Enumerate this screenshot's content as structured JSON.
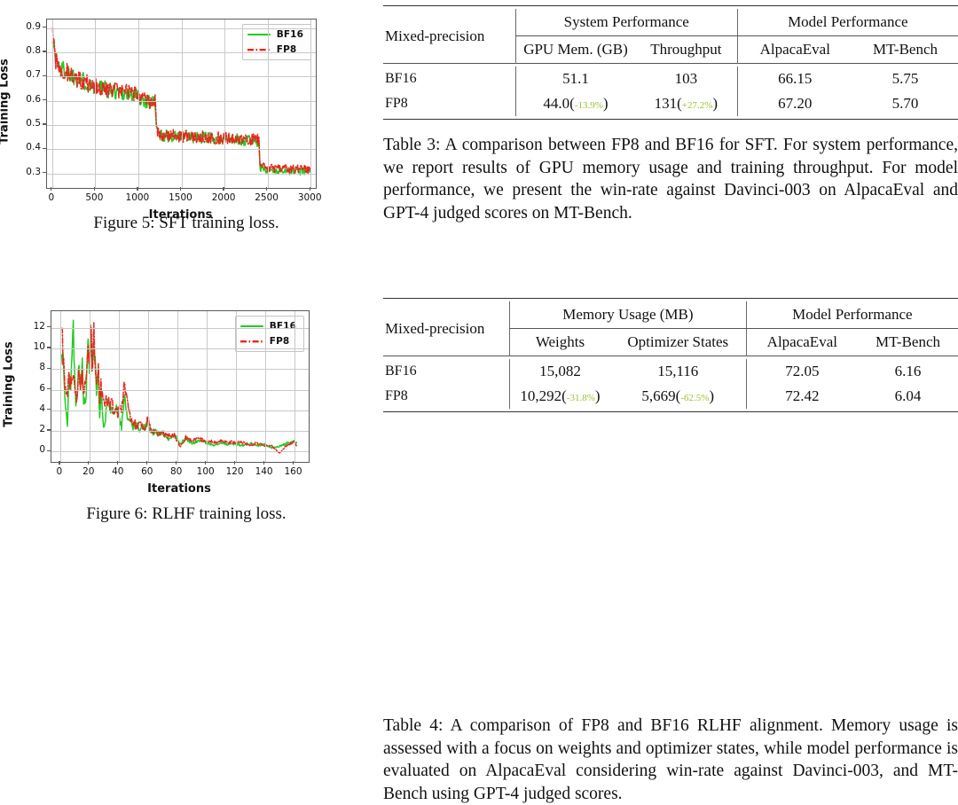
{
  "figures": [
    {
      "id": "figure5",
      "caption": "Figure 5: SFT training loss.",
      "chart_data": {
        "type": "line",
        "title": "",
        "xlabel": "Iterations",
        "ylabel": "Training Loss",
        "xlim": [
          -60,
          3060
        ],
        "ylim": [
          0.24,
          0.935
        ],
        "xticks": [
          "0",
          "500",
          "1000",
          "1500",
          "2000",
          "2500",
          "3000"
        ],
        "xtick_values": [
          0,
          500,
          1000,
          1500,
          2000,
          2500,
          3000
        ],
        "yticks": [
          "0.9",
          "0.8",
          "0.7",
          "0.6",
          "0.5",
          "0.4",
          "0.3"
        ],
        "ytick_values": [
          0.9,
          0.8,
          0.7,
          0.6,
          0.5,
          0.4,
          0.3
        ],
        "grid": true,
        "legend_position": "upper right",
        "series": [
          {
            "name": "BF16",
            "color": "#22cc22",
            "style": "solid",
            "x": [
              0,
              30,
              60,
              100,
              150,
              200,
              260,
              320,
              380,
              440,
              500,
              560,
              620,
              680,
              740,
              800,
              860,
              920,
              980,
              1040,
              1100,
              1160,
              1200,
              1210,
              1260,
              1320,
              1400,
              1480,
              1560,
              1640,
              1720,
              1800,
              1880,
              1960,
              2040,
              2120,
              2200,
              2280,
              2360,
              2400,
              2410,
              2480,
              2560,
              2640,
              2720,
              2800,
              2880,
              2960,
              3000
            ],
            "values": [
              0.89,
              0.79,
              0.755,
              0.735,
              0.722,
              0.712,
              0.7,
              0.69,
              0.678,
              0.668,
              0.66,
              0.655,
              0.648,
              0.643,
              0.64,
              0.636,
              0.632,
              0.628,
              0.618,
              0.607,
              0.6,
              0.596,
              0.592,
              0.475,
              0.458,
              0.455,
              0.452,
              0.45,
              0.45,
              0.448,
              0.447,
              0.446,
              0.444,
              0.443,
              0.442,
              0.44,
              0.438,
              0.437,
              0.436,
              0.434,
              0.322,
              0.318,
              0.315,
              0.313,
              0.312,
              0.311,
              0.31,
              0.309,
              0.308
            ]
          },
          {
            "name": "FP8",
            "color": "#e8271f",
            "style": "dashdot",
            "x": [
              0,
              30,
              60,
              100,
              150,
              200,
              260,
              320,
              380,
              440,
              500,
              560,
              620,
              680,
              740,
              800,
              860,
              920,
              980,
              1040,
              1100,
              1160,
              1200,
              1210,
              1260,
              1320,
              1400,
              1480,
              1560,
              1640,
              1720,
              1800,
              1880,
              1960,
              2040,
              2120,
              2200,
              2280,
              2360,
              2400,
              2410,
              2480,
              2560,
              2640,
              2720,
              2800,
              2880,
              2960,
              3000
            ],
            "values": [
              0.888,
              0.785,
              0.752,
              0.733,
              0.72,
              0.71,
              0.698,
              0.688,
              0.676,
              0.667,
              0.659,
              0.654,
              0.647,
              0.644,
              0.641,
              0.638,
              0.634,
              0.63,
              0.62,
              0.609,
              0.602,
              0.597,
              0.593,
              0.478,
              0.461,
              0.458,
              0.456,
              0.454,
              0.453,
              0.451,
              0.45,
              0.449,
              0.447,
              0.446,
              0.445,
              0.443,
              0.441,
              0.44,
              0.439,
              0.437,
              0.328,
              0.325,
              0.322,
              0.32,
              0.319,
              0.318,
              0.317,
              0.316,
              0.315
            ]
          }
        ]
      }
    },
    {
      "id": "figure6",
      "caption": "Figure 6: RLHF training loss.",
      "chart_data": {
        "type": "line",
        "title": "",
        "xlabel": "Iterations",
        "ylabel": "Training Loss",
        "xlim": [
          -6,
          170
        ],
        "ylim": [
          -1.0,
          13.6
        ],
        "xticks": [
          "0",
          "20",
          "40",
          "60",
          "80",
          "100",
          "120",
          "140",
          "160"
        ],
        "xtick_values": [
          0,
          20,
          40,
          60,
          80,
          100,
          120,
          140,
          160
        ],
        "yticks": [
          "12",
          "10",
          "8",
          "6",
          "4",
          "2",
          "0"
        ],
        "ytick_values": [
          12,
          10,
          8,
          6,
          4,
          2,
          0
        ],
        "grid": true,
        "legend_position": "upper right",
        "series": [
          {
            "name": "BF16",
            "color": "#22cc22",
            "style": "solid",
            "x": [
              1,
              3,
              5,
              6,
              7,
              9,
              10,
              11,
              13,
              14,
              15,
              16,
              18,
              19,
              20,
              21,
              22,
              23,
              24,
              25,
              26,
              27,
              28,
              30,
              32,
              34,
              36,
              38,
              40,
              42,
              44,
              46,
              48,
              50,
              52,
              55,
              58,
              60,
              62,
              65,
              68,
              70,
              74,
              78,
              82,
              86,
              90,
              95,
              100,
              105,
              110,
              115,
              120,
              125,
              130,
              135,
              140,
              145,
              150,
              155,
              160,
              162
            ],
            "values": [
              11.2,
              6.0,
              2.9,
              8.5,
              5.2,
              11.5,
              6.2,
              4.5,
              8.0,
              5.5,
              9.0,
              4.0,
              6.5,
              11.0,
              7.5,
              13.1,
              6.8,
              11.0,
              8.2,
              5.2,
              8.3,
              3.1,
              5.8,
              2.0,
              4.9,
              4.2,
              3.6,
              4.0,
              3.9,
              2.3,
              5.5,
              3.1,
              3.3,
              2.4,
              2.7,
              2.0,
              2.4,
              2.9,
              1.6,
              2.1,
              1.5,
              1.9,
              1.1,
              1.7,
              0.7,
              1.3,
              0.8,
              1.0,
              0.85,
              0.6,
              0.9,
              0.7,
              0.75,
              0.6,
              0.8,
              0.55,
              0.7,
              0.35,
              0.5,
              0.8,
              0.95,
              0.75
            ]
          },
          {
            "name": "FP8",
            "color": "#e8271f",
            "style": "dashdot",
            "x": [
              1,
              3,
              5,
              6,
              7,
              9,
              10,
              11,
              13,
              14,
              15,
              16,
              18,
              19,
              20,
              21,
              22,
              23,
              24,
              25,
              26,
              27,
              28,
              30,
              32,
              34,
              36,
              38,
              40,
              42,
              44,
              46,
              48,
              50,
              52,
              55,
              58,
              60,
              62,
              65,
              68,
              70,
              74,
              78,
              82,
              86,
              90,
              95,
              100,
              105,
              110,
              115,
              120,
              125,
              130,
              135,
              140,
              145,
              150,
              155,
              160,
              162
            ],
            "values": [
              11.4,
              6.8,
              5.6,
              8.0,
              6.0,
              8.8,
              7.1,
              5.2,
              7.7,
              6.4,
              8.0,
              5.0,
              7.2,
              9.8,
              8.4,
              11.6,
              8.0,
              11.2,
              9.0,
              6.3,
              9.1,
              4.4,
              6.4,
              4.5,
              5.0,
              4.6,
              4.4,
              4.1,
              3.8,
              4.4,
              6.3,
              4.4,
              3.0,
              3.0,
              2.5,
              2.6,
              2.2,
              3.4,
              1.9,
              2.0,
              1.7,
              1.8,
              1.5,
              1.6,
              0.45,
              1.4,
              1.1,
              1.2,
              1.05,
              0.95,
              1.0,
              0.95,
              0.85,
              0.9,
              0.6,
              0.85,
              0.6,
              0.55,
              -0.15,
              0.6,
              1.0,
              0.45
            ]
          }
        ]
      }
    }
  ],
  "table3": {
    "group_header_left": "Mixed-precision",
    "group_headers": [
      "System Performance",
      "Model Performance"
    ],
    "sub_headers": [
      "GPU Mem. (GB)",
      "Throughput",
      "AlpacaEval",
      "MT-Bench"
    ],
    "rows": [
      {
        "name": "BF16",
        "gpu_mem": "51.1",
        "gpu_mem_delta": "",
        "throughput": "103",
        "throughput_delta": "",
        "alpaca_eval": "66.15",
        "mt_bench": "5.75"
      },
      {
        "name": "FP8",
        "gpu_mem": "44.0",
        "gpu_mem_delta": "-13.9%",
        "throughput": "131",
        "throughput_delta": "+27.2%",
        "alpaca_eval": "67.20",
        "mt_bench": "5.70"
      }
    ],
    "caption": "Table 3: A comparison between FP8 and BF16 for SFT. For system performance, we report results of GPU memory usage and training throughput. For model performance, we present the win-rate against Davinci-003 on AlpacaEval and GPT-4 judged scores on MT-Bench."
  },
  "table4": {
    "group_header_left": "Mixed-precision",
    "group_headers": [
      "Memory Usage (MB)",
      "Model Performance"
    ],
    "sub_headers": [
      "Weights",
      "Optimizer States",
      "AlpacaEval",
      "MT-Bench"
    ],
    "rows": [
      {
        "name": "BF16",
        "weights": "15,082",
        "weights_delta": "",
        "optimizer_states": "15,116",
        "optimizer_states_delta": "",
        "alpaca_eval": "72.05",
        "mt_bench": "6.16"
      },
      {
        "name": "FP8",
        "weights": "10,292",
        "weights_delta": "-31.8%",
        "optimizer_states": "5,669",
        "optimizer_states_delta": "-62.5%",
        "alpaca_eval": "72.42",
        "mt_bench": "6.04"
      }
    ],
    "caption": "Table 4: A comparison of FP8 and BF16 RLHF alignment. Memory usage is assessed with a focus on weights and optimizer states, while model performance is evaluated on AlpacaEval considering win-rate against Davinci-003, and MT-Bench using GPT-4 judged scores."
  },
  "colors": {
    "bf16_line": "#22cc22",
    "fp8_line": "#e8271f",
    "delta_green": "#9ac22e",
    "rule": "#333333",
    "grid": "#c9c9c9"
  }
}
